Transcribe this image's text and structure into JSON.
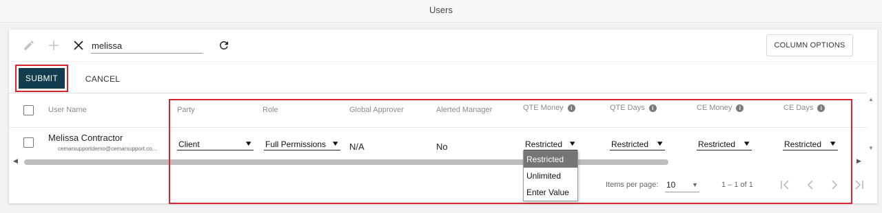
{
  "window": {
    "title": "Users"
  },
  "toolbar": {
    "search_value": "melissa",
    "column_options_label": "COLUMN OPTIONS"
  },
  "actions": {
    "submit_label": "SUBMIT",
    "cancel_label": "CANCEL"
  },
  "table": {
    "headers": {
      "user_name": "User Name",
      "party": "Party",
      "role": "Role",
      "global_approver": "Global Approver",
      "alerted_manager": "Alerted Manager",
      "qte_money": "QTE Money",
      "qte_days": "QTE Days",
      "ce_money": "CE Money",
      "ce_days": "CE Days"
    },
    "row": {
      "name": "Melissa Contractor",
      "email": "cemarsupportdemo@cemarsupport.co...",
      "party": "Client",
      "role": "Full Permissions",
      "global_approver": "N/A",
      "alerted_manager": "No",
      "qte_money": "Restricted",
      "qte_days": "Restricted",
      "ce_money": "Restricted",
      "ce_days": "Restricted"
    }
  },
  "dropdown": {
    "options": [
      "Restricted",
      "Unlimited",
      "Enter Value"
    ],
    "selected": "Restricted"
  },
  "paginator": {
    "items_per_page_label": "Items per page:",
    "items_per_page_value": "10",
    "range_label": "1 – 1 of 1"
  },
  "colors": {
    "submit_bg": "#113d4f",
    "highlight_border": "#d9232e",
    "dropdown_active_bg": "#757575"
  },
  "icons": [
    "pencil-icon",
    "plus-icon",
    "close-icon",
    "refresh-icon",
    "info-icon",
    "caret-down-icon",
    "first-page-icon",
    "prev-page-icon",
    "next-page-icon",
    "last-page-icon"
  ]
}
